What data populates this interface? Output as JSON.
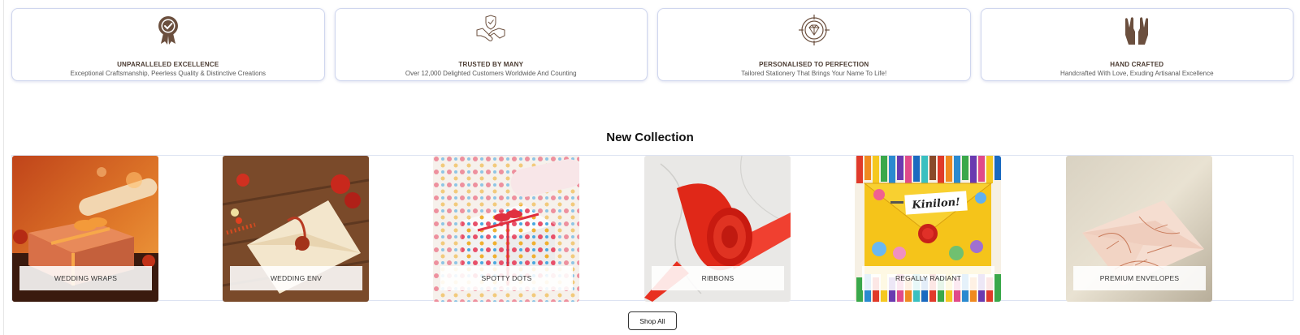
{
  "features": [
    {
      "icon": "award-badge-icon",
      "title": "UNPARALLELED EXCELLENCE",
      "subtitle": "Exceptional Craftsmanship, Peerless Quality & Distinctive Creations"
    },
    {
      "icon": "handshake-shield-icon",
      "title": "TRUSTED BY MANY",
      "subtitle": "Over 12,000 Delighted Customers Worldwide And Counting"
    },
    {
      "icon": "diamond-target-icon",
      "title": "PERSONALISED TO PERFECTION",
      "subtitle": "Tailored Stationery That Brings Your Name To Life!"
    },
    {
      "icon": "hands-icon",
      "title": "HAND CRAFTED",
      "subtitle": "Handcrafted With Love, Exuding Artisanal Excellence"
    }
  ],
  "collection": {
    "title": "New Collection",
    "items": [
      {
        "label": "WEDDING WRAPS"
      },
      {
        "label": "WEDDING ENV"
      },
      {
        "label": "SPOTTY DOTS"
      },
      {
        "label": "RIBBONS"
      },
      {
        "label": "REGALLY RADIANT",
        "image_text": "Kinilon!"
      },
      {
        "label": "PREMIUM ENVELOPES"
      }
    ],
    "shop_all": "Shop All"
  },
  "colors": {
    "icon_brown": "#6b4f3e",
    "card_border": "#cfd6ee"
  }
}
